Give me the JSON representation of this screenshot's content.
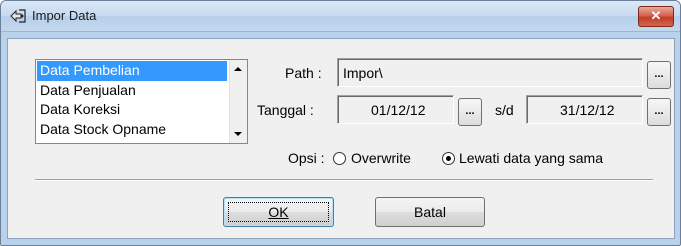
{
  "window": {
    "title": "Impor Data",
    "close_icon": "close-icon"
  },
  "list": {
    "items": [
      "Data Pembelian",
      "Data Penjualan",
      "Data Koreksi",
      "Data Stock Opname"
    ],
    "selected_index": 0
  },
  "path": {
    "label": "Path :",
    "value": "Impor\\",
    "browse_label": "..."
  },
  "tanggal": {
    "label": "Tanggal :",
    "from": "01/12/12",
    "separator": "s/d",
    "to": "31/12/12",
    "picker_label": "..."
  },
  "opsi": {
    "label": "Opsi :",
    "option1": "Overwrite",
    "option2": "Lewati  data yang sama",
    "selected": "option2"
  },
  "buttons": {
    "ok_label": "OK",
    "cancel_label": "Batal"
  },
  "colors": {
    "selection": "#3399ff",
    "title_bar": "#c6daf0",
    "close_button": "#c23d24"
  }
}
